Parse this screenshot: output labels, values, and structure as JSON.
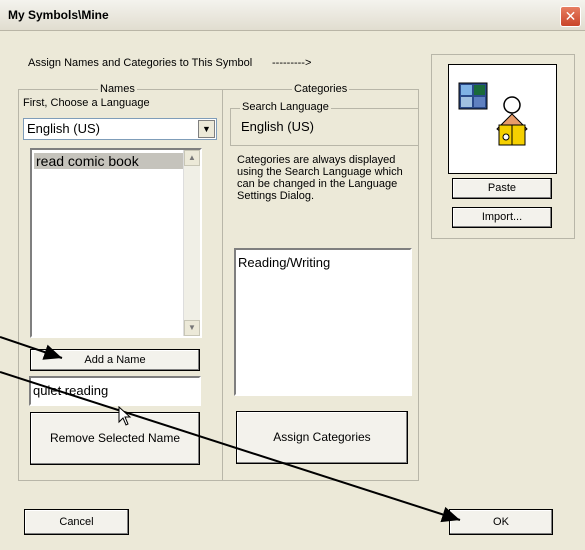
{
  "window": {
    "title": "My Symbols\\Mine",
    "close_label": "✕"
  },
  "header": {
    "instruction": "Assign Names and Categories to This Symbol",
    "arrow_text": "--------->"
  },
  "names": {
    "group_label": "Names",
    "choose_language_label": "First, Choose a Language",
    "language_value": "English (US)",
    "list_items": [
      "read comic book"
    ],
    "add_button": "Add a Name",
    "new_name_value": "quiet reading",
    "remove_button": "Remove Selected Name"
  },
  "categories": {
    "group_label": "Categories",
    "search_language_label": "Search Language",
    "search_language_value": "English (US)",
    "note": "Categories are always displayed using the Search Language which can be changed in the Language Settings Dialog.",
    "list_items": [
      "Reading/Writing"
    ],
    "assign_button": "Assign Categories"
  },
  "symbol": {
    "icon": "person-reading-comic-icon",
    "paste_button": "Paste",
    "import_button": "Import..."
  },
  "footer": {
    "cancel_button": "Cancel",
    "ok_button": "OK"
  }
}
